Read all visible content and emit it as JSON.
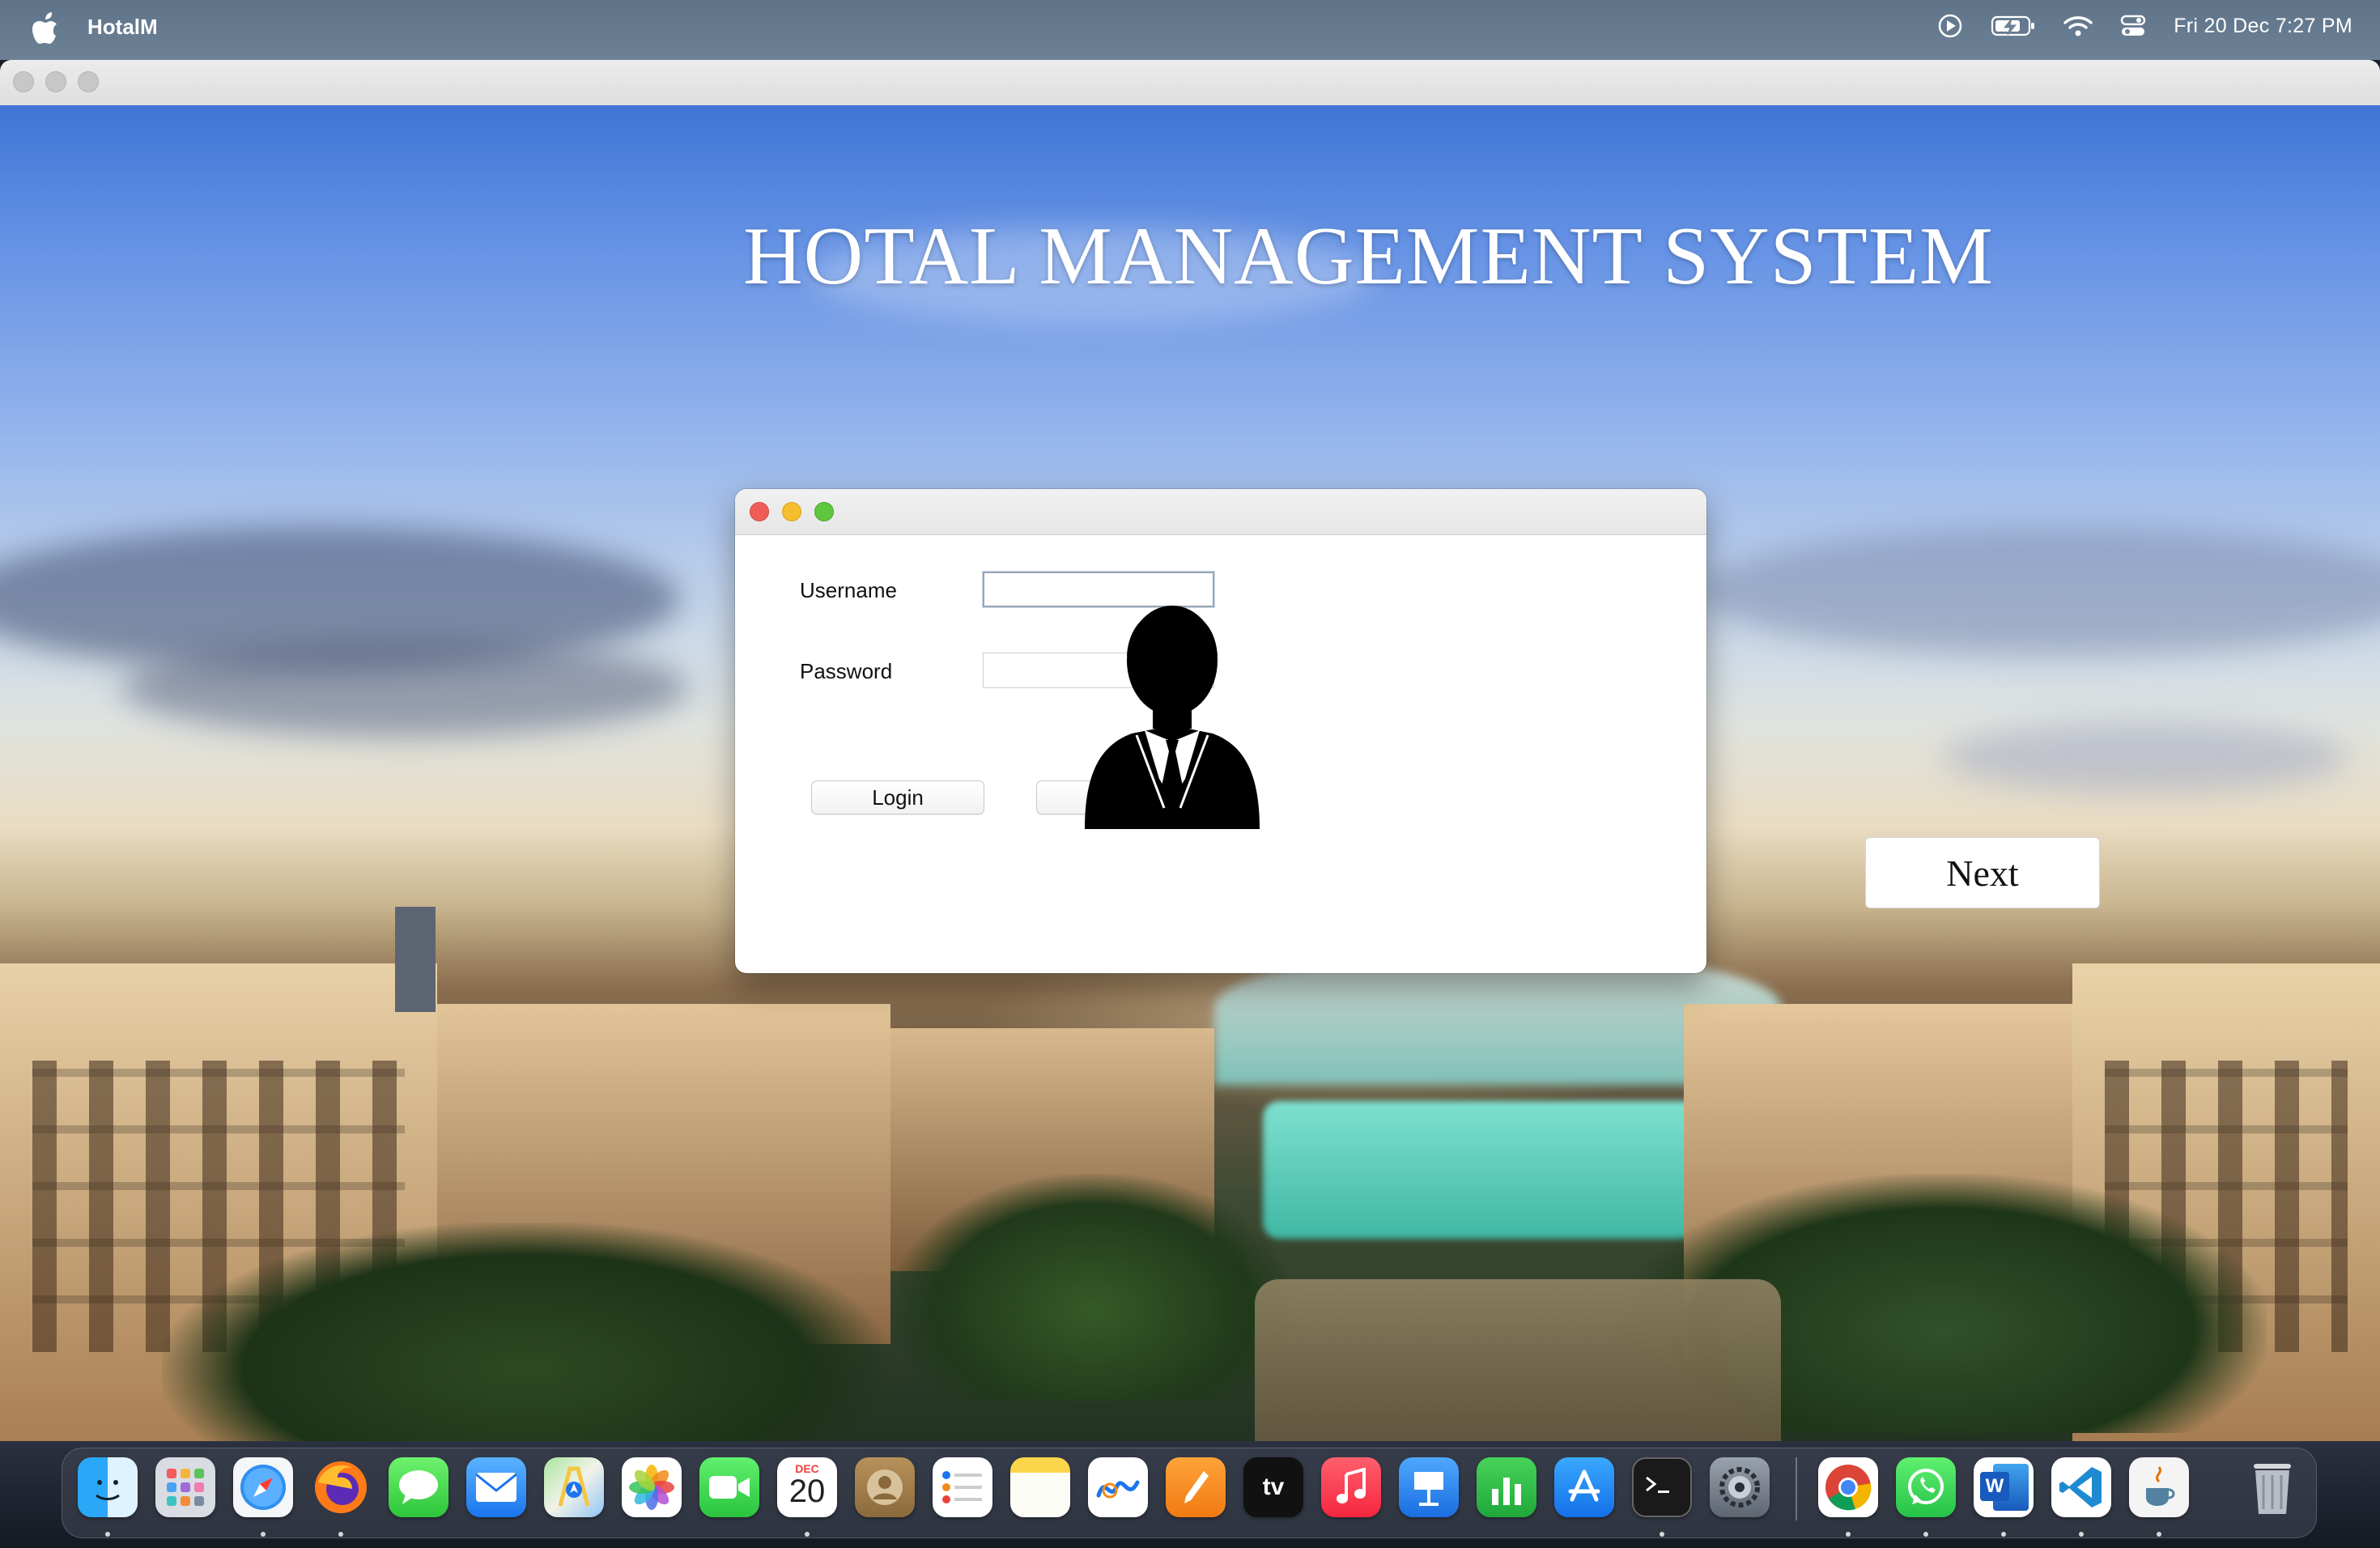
{
  "menubar": {
    "app_name": "HotalM",
    "clock": "Fri 20 Dec  7:27 PM",
    "status_icons": [
      "play-circle-icon",
      "battery-charging-icon",
      "wifi-icon",
      "control-center-icon"
    ]
  },
  "window": {
    "app_title": "HOTAL MANAGEMENT SYSTEM",
    "next_label": "Next"
  },
  "login_dialog": {
    "username_label": "Username",
    "username_value": "",
    "password_label": "Password",
    "password_value": "",
    "login_label": "Login",
    "cancel_label": "Cancel",
    "avatar_icon": "businessman-avatar-icon"
  },
  "dock": {
    "calendar_month": "DEC",
    "calendar_day": "20",
    "word_letter": "W",
    "appletv_label": "tv",
    "apps": [
      "Finder",
      "Launchpad",
      "Safari",
      "Firefox",
      "Messages",
      "Mail",
      "Maps",
      "Photos",
      "FaceTime",
      "Calendar",
      "Contacts",
      "Reminders",
      "Notes",
      "Freeform",
      "Pages",
      "Apple TV",
      "Music",
      "Keynote",
      "Numbers",
      "App Store",
      "Terminal",
      "System Settings",
      "Chrome",
      "WhatsApp",
      "Word",
      "VS Code",
      "Java",
      "Trash"
    ]
  },
  "colors": {
    "menubar": "#6d8196",
    "close": "#ee5e57",
    "minimize": "#f5be2f",
    "zoom": "#5fc640",
    "dialog_bg": "#ffffff"
  }
}
